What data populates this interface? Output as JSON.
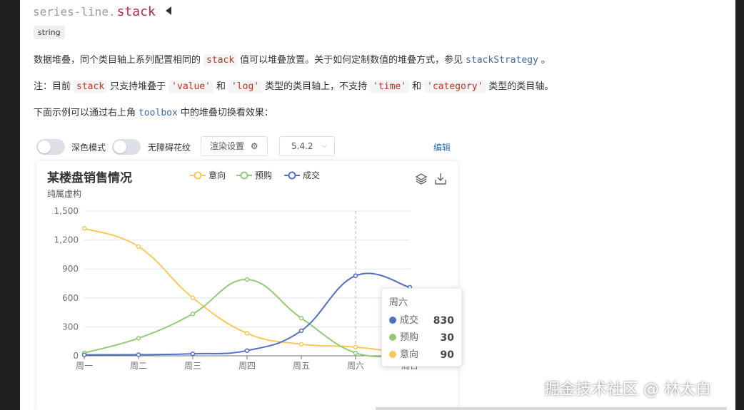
{
  "heading": {
    "prefix": "series-line.",
    "name": "stack"
  },
  "type_badge": "string",
  "para1": {
    "t1": "数据堆叠，同个类目轴上系列配置相同的",
    "c1": "stack",
    "t2": "值可以堆叠放置。关于如何定制数值的堆叠方式，参见",
    "link": "stackStrategy",
    "t3": "。"
  },
  "para2": {
    "t1": "注：目前",
    "c1": "stack",
    "t2": "只支持堆叠于",
    "c2": "'value'",
    "t3": "和",
    "c3": "'log'",
    "t4": "类型的类目轴上，不支持",
    "c4": "'time'",
    "t5": "和",
    "c5": "'category'",
    "t6": "类型的类目轴。"
  },
  "para3": {
    "t1": "下面示例可以通过右上角",
    "link": "toolbox",
    "t2": "中的堆叠切换看效果："
  },
  "toolbar": {
    "dark_mode_label": "深色模式",
    "a11y_label": "无障碍花纹",
    "render_settings_label": "渲染设置",
    "version_label": "5.4.2",
    "edit_label": "编辑"
  },
  "colors": {
    "deal": "#5470c6",
    "booking": "#91cc75",
    "intent": "#fac858"
  },
  "chart_data": {
    "type": "line",
    "title": "某楼盘销售情况",
    "subtitle": "纯属虚构",
    "categories": [
      "周一",
      "周二",
      "周三",
      "周四",
      "周五",
      "周六",
      "周日"
    ],
    "y_ticks": [
      "0",
      "300",
      "600",
      "900",
      "1,200",
      "1,500"
    ],
    "ylim": [
      0,
      1500
    ],
    "smooth": true,
    "legend_position": "top-center",
    "series": [
      {
        "name": "意向",
        "color": "#fac858",
        "values": [
          1320,
          1132,
          601,
          234,
          120,
          90,
          20
        ]
      },
      {
        "name": "预购",
        "color": "#91cc75",
        "values": [
          30,
          182,
          434,
          791,
          390,
          30,
          10
        ]
      },
      {
        "name": "成交",
        "color": "#5470c6",
        "values": [
          10,
          12,
          21,
          54,
          260,
          830,
          710
        ]
      }
    ],
    "hover_index": 5
  },
  "tooltip": {
    "title": "周六",
    "rows": [
      {
        "name": "成交",
        "value": "830",
        "color": "#5470c6"
      },
      {
        "name": "预购",
        "value": "30",
        "color": "#91cc75"
      },
      {
        "name": "意向",
        "value": "90",
        "color": "#fac858"
      }
    ]
  },
  "watermark": "掘金技术社区 @ 林太白"
}
